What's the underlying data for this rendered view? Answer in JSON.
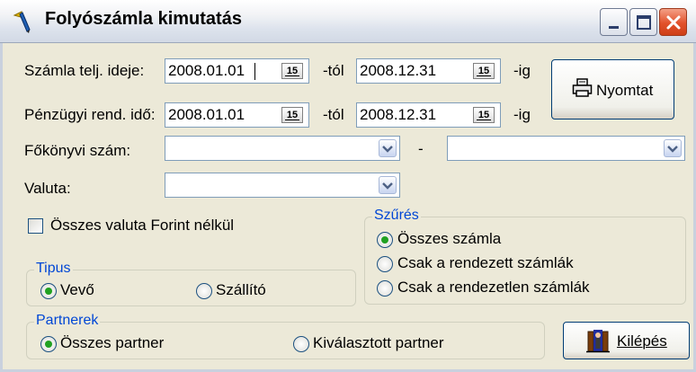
{
  "window": {
    "title": "Folyószámla kimutatás",
    "app_icon": "pen-icon",
    "controls": [
      "minimize-icon",
      "maximize-icon",
      "close-icon"
    ]
  },
  "form": {
    "szamla_telj_label": "Számla telj. ideje:",
    "szamla_telj_from": "2008.01.01",
    "szamla_telj_to": "2008.12.31",
    "penzugyi_label": "Pénzügyi rend. idő:",
    "penzugyi_from": "2008.01.01",
    "penzugyi_to": "2008.12.31",
    "tol": "-tól",
    "ig": "-ig",
    "calendar_glyph": "15",
    "fokonyvi_label": "Főkönyvi szám:",
    "fokonyvi_from": "",
    "fokonyvi_to": "",
    "dash": "-",
    "valuta_label": "Valuta:",
    "valuta_value": "",
    "osszes_valuta_label": "Összes valuta Forint nélkül",
    "osszes_valuta_checked": false
  },
  "buttons": {
    "print_label": "Nyomtat",
    "exit_label": "Kilépés"
  },
  "szures": {
    "title": "Szűrés",
    "options": [
      "Összes számla",
      "Csak a rendezett számlák",
      "Csak a rendezetlen számlák"
    ],
    "selected": "Összes számla"
  },
  "tipus": {
    "title": "Tipus",
    "options": [
      "Vevő",
      "Szállító"
    ],
    "selected": "Vevő"
  },
  "partnerek": {
    "title": "Partnerek",
    "options": [
      "Összes partner",
      "Kiválasztott partner"
    ],
    "selected": "Összes partner"
  },
  "colors": {
    "window_bg": "#ECE9D8",
    "group_title": "#0046D5",
    "radio_dot": "#21A121",
    "close_button": "#E2512B"
  }
}
